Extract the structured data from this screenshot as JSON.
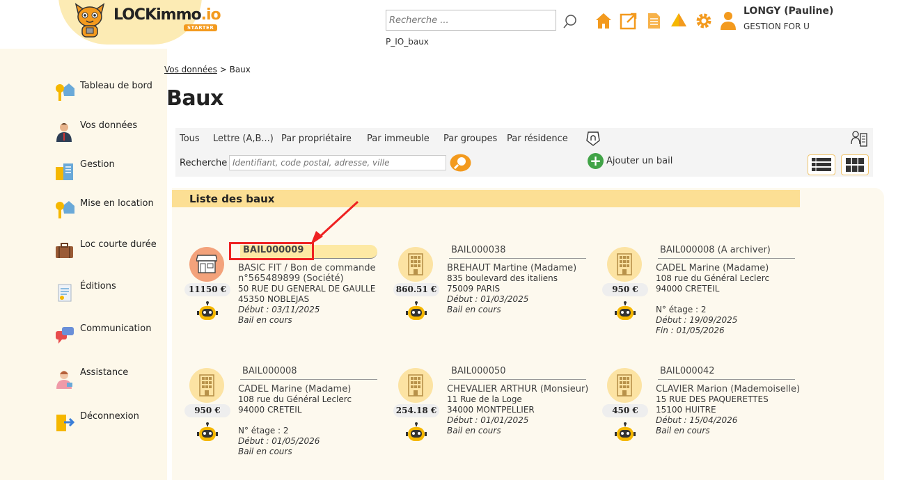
{
  "brand": {
    "name_main": "LOCKimmo",
    "name_suffix": ".io",
    "edition": "STARTER"
  },
  "header": {
    "search_placeholder": "Recherche ...",
    "environment": "P_IO_baux",
    "user_name": "LONGY (Pauline)",
    "user_org": "GESTION FOR U"
  },
  "sidebar": {
    "items": [
      {
        "label": "Tableau de bord",
        "icon": "key-house-icon"
      },
      {
        "label": "Vos données",
        "icon": "person-icon"
      },
      {
        "label": "Gestion",
        "icon": "building-doc-icon"
      },
      {
        "label": "Mise en location",
        "icon": "key-house-icon"
      },
      {
        "label": "Loc courte durée",
        "icon": "suitcase-icon"
      },
      {
        "label": "Éditions",
        "icon": "document-icon"
      },
      {
        "label": "Communication",
        "icon": "chat-bubbles-icon"
      },
      {
        "label": "Assistance",
        "icon": "support-agent-icon"
      },
      {
        "label": "Déconnexion",
        "icon": "logout-door-icon"
      }
    ]
  },
  "breadcrumb": {
    "link": "Vos données",
    "separator": ">",
    "current": "Baux"
  },
  "page": {
    "title": "Baux"
  },
  "filters": {
    "tabs": [
      "Tous",
      "Lettre (A,B...)",
      "Par propriétaire",
      "Par immeuble",
      "Par groupes",
      "Par résidence"
    ],
    "search_label": "Recherche",
    "search_placeholder": "Identifiant, code postal, adresse, ville",
    "add_label": "Ajouter un bail"
  },
  "list": {
    "title": "Liste des baux",
    "cards": [
      {
        "ref": "BAIL000009",
        "type": "shop",
        "price": "11150 €",
        "lines": [
          "BASIC FIT / Bon de commande n°565489899 (Société)",
          "50 RUE DU GENERAL DE GAULLE",
          "45350 NOBLEJAS"
        ],
        "floor": "",
        "start": "Début : 03/11/2025",
        "end": "",
        "status": "Bail en cours"
      },
      {
        "ref": "BAIL000038",
        "type": "building",
        "price": "860.51 €",
        "lines": [
          "BREHAUT Martine (Madame)",
          "835 boulevard des italiens",
          "75009 PARIS"
        ],
        "floor": "",
        "start": "Début : 01/03/2025",
        "end": "",
        "status": "Bail en cours"
      },
      {
        "ref": "BAIL000008 (A archiver)",
        "type": "building",
        "price": "950 €",
        "lines": [
          "CADEL Marine (Madame)",
          "108 rue du Général Leclerc",
          "94000 CRETEIL"
        ],
        "floor": "N° étage : 2",
        "start": "Début : 19/09/2025",
        "end": "Fin : 01/05/2026",
        "status": ""
      },
      {
        "ref": "BAIL000008",
        "type": "building",
        "price": "950 €",
        "lines": [
          "CADEL Marine (Madame)",
          "108 rue du Général Leclerc",
          "94000 CRETEIL"
        ],
        "floor": "N° étage : 2",
        "start": "Début : 01/05/2026",
        "end": "",
        "status": "Bail en cours"
      },
      {
        "ref": "BAIL000050",
        "type": "building",
        "price": "254.18 €",
        "lines": [
          "CHEVALIER ARTHUR (Monsieur)",
          "11 Rue de la Loge",
          "34000 MONTPELLIER"
        ],
        "floor": "",
        "start": "Début : 01/01/2025",
        "end": "",
        "status": "Bail en cours"
      },
      {
        "ref": "BAIL000042",
        "type": "building",
        "price": "450 €",
        "lines": [
          "CLAVIER Marion (Mademoiselle)",
          "15 RUE DES PAQUERETTES",
          "15100 HUITRE"
        ],
        "floor": "",
        "start": "Début : 15/04/2026",
        "end": "",
        "status": "Bail en cours"
      }
    ]
  },
  "colors": {
    "accent": "#f39a1e",
    "highlight": "#fcdf94",
    "annotation": "#e22222",
    "add_green": "#41a347"
  }
}
